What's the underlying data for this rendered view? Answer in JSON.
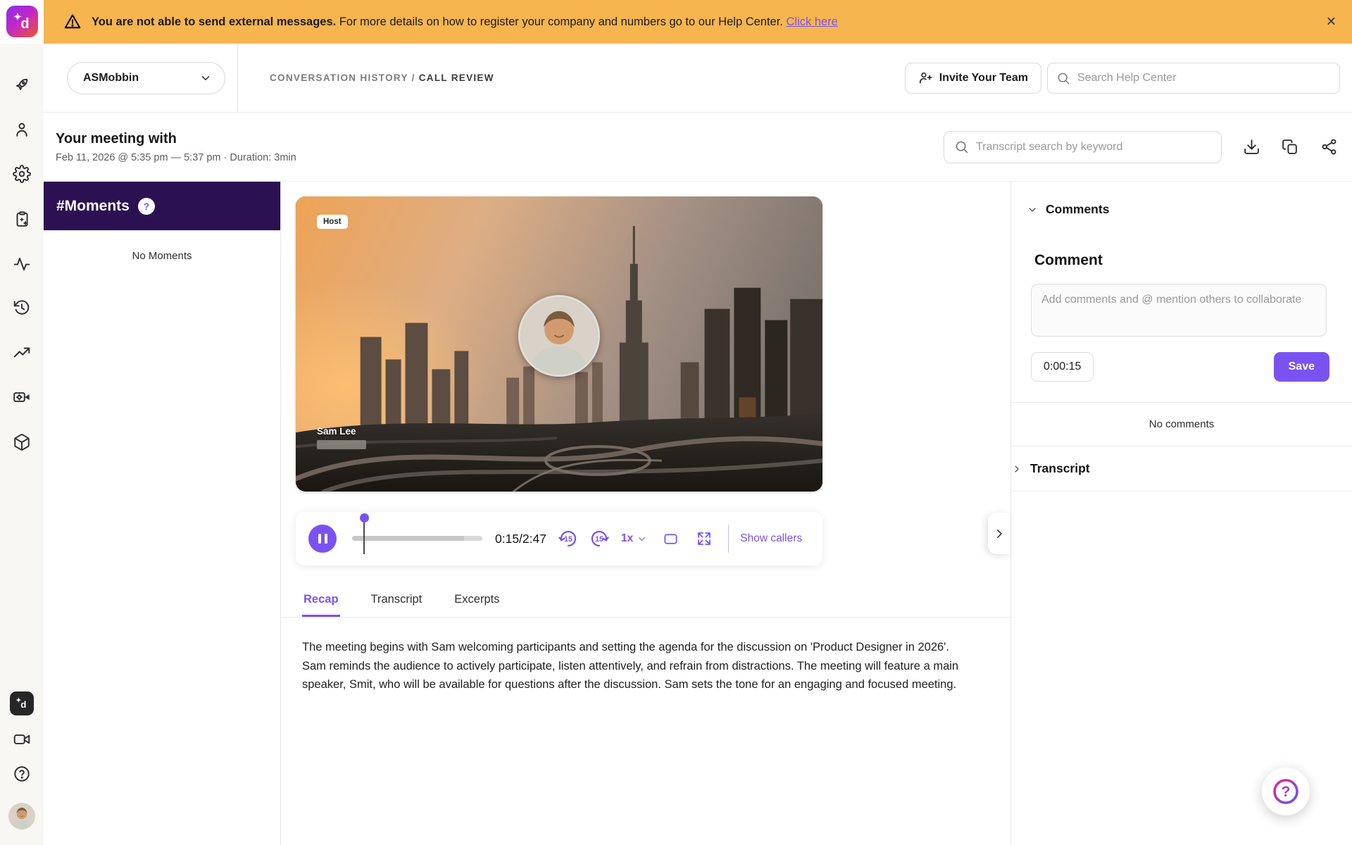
{
  "banner": {
    "warning_icon": "triangle-alert-icon",
    "bold_text": "You are not able to send external messages.",
    "body_text": "For more details on how to register your company and numbers go to our Help Center.",
    "link_label": "Click here",
    "close_glyph": "✕"
  },
  "brand": {
    "logo_letter": "d",
    "logo_mark": "sparkle-icon"
  },
  "sidebar": {
    "top_icons": [
      "rocket-icon",
      "user-icon",
      "settings-gear-icon",
      "ai-notes-clipboard-icon",
      "activity-pulse-icon",
      "history-clock-icon",
      "trending-up-icon",
      "video-settings-icon",
      "integrations-box-icon"
    ],
    "bottom_icons": [
      "dialpad-ai-app-icon",
      "video-camera-icon",
      "help-circle-icon",
      "user-avatar"
    ]
  },
  "header": {
    "workspace_name": "ASMobbin",
    "breadcrumb_section": "CONVERSATION HISTORY",
    "breadcrumb_separator": "/",
    "breadcrumb_page": "CALL REVIEW",
    "invite_button_label": "Invite Your Team",
    "help_search_placeholder": "Search Help Center"
  },
  "meeting": {
    "title": "Your meeting with",
    "datetime_line": "Feb 11, 2026 @ 5:35 pm — 5:37 pm · Duration: 3min",
    "transcript_search_placeholder": "Transcript search by keyword",
    "action_icons": [
      "download-icon",
      "copy-icon",
      "share-icon"
    ]
  },
  "moments": {
    "title": "#Moments",
    "help_badge": "?",
    "empty_text": "No Moments"
  },
  "player": {
    "host_badge": "Host",
    "participant_name": "Sam Lee",
    "time_display": "0:15/2:47",
    "skip_back_label": "15",
    "skip_forward_label": "15",
    "speed_label": "1x",
    "show_callers_label": "Show callers",
    "progress_percent": 9,
    "state": "playing"
  },
  "tabs": {
    "items": [
      {
        "label": "Recap",
        "active": true
      },
      {
        "label": "Transcript",
        "active": false
      },
      {
        "label": "Excerpts",
        "active": false
      }
    ]
  },
  "recap_text": "The meeting begins with Sam welcoming participants and setting the agenda for the discussion on 'Product Designer in 2026'. Sam reminds the audience to actively participate, listen attentively, and refrain from distractions. The meeting will feature a main speaker, Smit, who will be available for questions after the discussion. Sam sets the tone for an engaging and focused meeting.",
  "comments_panel": {
    "section_title": "Comments",
    "form_heading": "Comment",
    "input_placeholder": "Add comments and @ mention others to collaborate",
    "timestamp_chip": "0:00:15",
    "save_label": "Save",
    "empty_text": "No comments",
    "transcript_section_title": "Transcript"
  },
  "colors": {
    "accent_purple": "#7B52F2",
    "banner_amber": "#F6B54E",
    "moments_header_purple": "#2B1152"
  }
}
